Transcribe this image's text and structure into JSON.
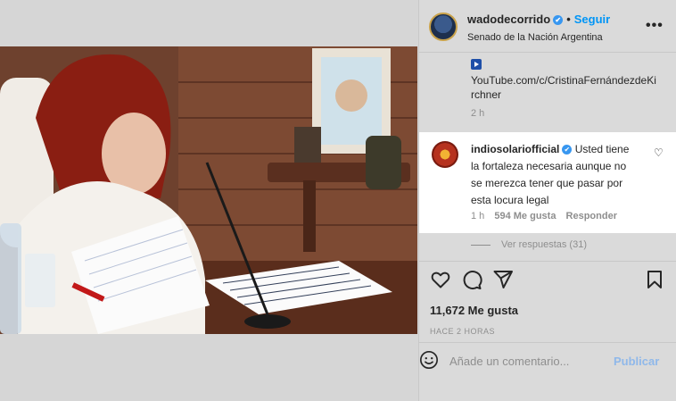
{
  "post": {
    "username": "wadodecorrido",
    "verified_mark": "✔",
    "separator": "•",
    "follow_label": "Seguir",
    "subtitle": "Senado de la Nación Argentina",
    "more_label": "•••"
  },
  "caption": {
    "link_icon": "play-icon",
    "link_text": "YouTube.com/c/CristinaFernándezdeKirchner",
    "time": "2 h"
  },
  "comment": {
    "username": "indiosolariofficial",
    "verified_mark": "✔",
    "text": "Usted tiene la fortaleza necesaria aunque no se merezca tener que pasar por esta locura legal",
    "time": "1 h",
    "likes": "594 Me gusta",
    "reply_label": "Responder",
    "heart_icon": "♡"
  },
  "replies_label": "Ver respuestas (31)",
  "actions": {
    "likes_count": "11,672 Me gusta",
    "posted_ago": "HACE 2 HORAS"
  },
  "comment_box": {
    "placeholder": "Añade un comentario...",
    "publish_label": "Publicar"
  },
  "colors": {
    "accent": "#0095f6",
    "publish_disabled": "#8fb8ea",
    "muted": "#8e8e8e"
  }
}
